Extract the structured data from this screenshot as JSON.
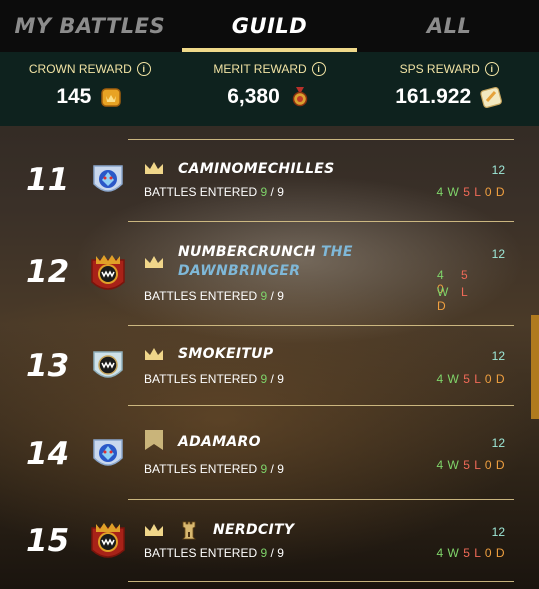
{
  "tabs": [
    {
      "label": "MY BATTLES",
      "active": false
    },
    {
      "label": "GUILD",
      "active": true
    },
    {
      "label": "ALL",
      "active": false
    }
  ],
  "rewards": {
    "crown": {
      "title": "CROWN REWARD",
      "value": "145",
      "icon": "crown-token-icon"
    },
    "merit": {
      "title": "MERIT REWARD",
      "value": "6,380",
      "icon": "merit-medal-icon"
    },
    "sps": {
      "title": "SPS REWARD",
      "value": "161.922",
      "icon": "sps-token-icon"
    }
  },
  "rows": [
    {
      "rank": "11",
      "name": "CAMINOMECHILLES",
      "title": "",
      "battles_label": "BATTLES ENTERED",
      "entered": "9",
      "total": "9",
      "score": "12",
      "w": "4 W",
      "l": "5 L",
      "d": "0 D",
      "badge": "crown",
      "guild_icon": "blue-dragon-crest-icon"
    },
    {
      "rank": "12",
      "name": "NUMBERCRUNCH",
      "title": "THE DAWNBRINGER",
      "battles_label": "BATTLES ENTERED",
      "entered": "9",
      "total": "9",
      "score": "12",
      "w_num": "4",
      "l_num": "5",
      "d_num": "0",
      "w_letter": "W",
      "l_letter": "L",
      "d_letter": "D",
      "badge": "crown",
      "guild_icon": "red-monster-crest-icon"
    },
    {
      "rank": "13",
      "name": "SMOKEITUP",
      "title": "",
      "battles_label": "BATTLES ENTERED",
      "entered": "9",
      "total": "9",
      "score": "12",
      "w": "4 W",
      "l": "5 L",
      "d": "0 D",
      "badge": "crown",
      "guild_icon": "silver-monster-crest-icon"
    },
    {
      "rank": "14",
      "name": "ADAMARO",
      "title": "",
      "battles_label": "BATTLES ENTERED",
      "entered": "9",
      "total": "9",
      "score": "12",
      "w": "4 W",
      "l": "5 L",
      "d": "0 D",
      "badge": "pennant",
      "guild_icon": "blue-dragon-crest-icon"
    },
    {
      "rank": "15",
      "name": "NERDCITY",
      "title": "",
      "battles_label": "BATTLES ENTERED",
      "entered": "9",
      "total": "9",
      "score": "12",
      "w": "4 W",
      "l": "5 L",
      "d": "0 D",
      "badge": "crown",
      "extra_badge": "tower-icon",
      "guild_icon": "red-monster-crest-icon"
    }
  ],
  "colors": {
    "accent": "#efd98a",
    "win": "#7fd46a",
    "loss": "#f06a58",
    "draw": "#f0a040",
    "score": "#9ee8d8"
  }
}
